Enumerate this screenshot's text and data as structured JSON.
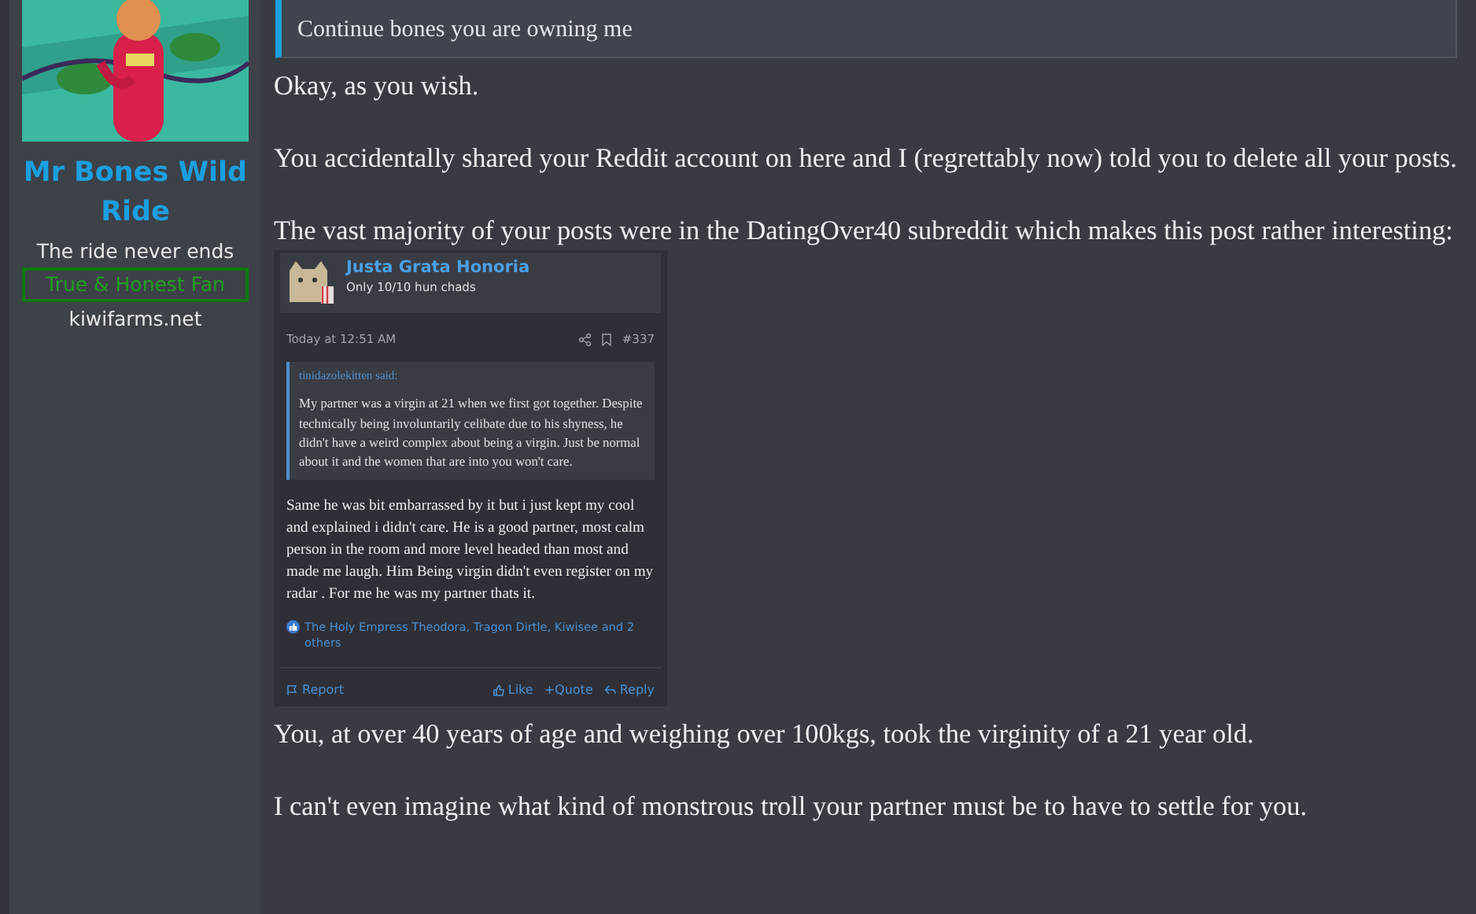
{
  "sidebar": {
    "username": "Mr Bones Wild Ride",
    "user_title": "The ride never ends",
    "banner": "True & Honest Fan",
    "location": "kiwifarms.net"
  },
  "quote": {
    "text": "Continue bones you are owning me"
  },
  "post": {
    "paragraphs_before": [
      "Okay, as you wish.",
      "You accidentally shared your Reddit account on here and I (regrettably now) told you to delete all your posts.",
      "The vast majority of your posts were in the DatingOver40 subreddit which makes this post rather interesting:"
    ],
    "embedded_screenshot": {
      "username": "Justa Grata Honoria",
      "user_title": "Only 10/10 hun chads",
      "time": "Today at 12:51 AM",
      "post_number": "#337",
      "quote_author": "tinidazolekitten said:",
      "quote_text": "My partner was a virgin at 21 when we first got together. Despite technically being involuntarily celibate due to his shyness, he didn't have a weird complex about being a virgin. Just be normal about it and the women that are into you won't care.",
      "body": "Same he was bit embarrassed by it but i just kept my cool and explained i didn't care. He is a good partner, most calm person in the room and more level headed than most and made me laugh. Him Being virgin didn't even register on my radar . For me he was my partner thats it.",
      "reactions": "The Holy Empress Theodora, Tragon Dirtle, Kiwisee and 2 others",
      "actions": [
        "Report",
        "Like",
        "+Quote",
        "Reply"
      ]
    },
    "paragraphs_after": [
      "You, at over 40 years of age and weighing over 100kgs, took the virginity of a 21 year old.",
      "I can't even imagine what kind of monstrous troll your partner must be to have to settle for you."
    ]
  }
}
